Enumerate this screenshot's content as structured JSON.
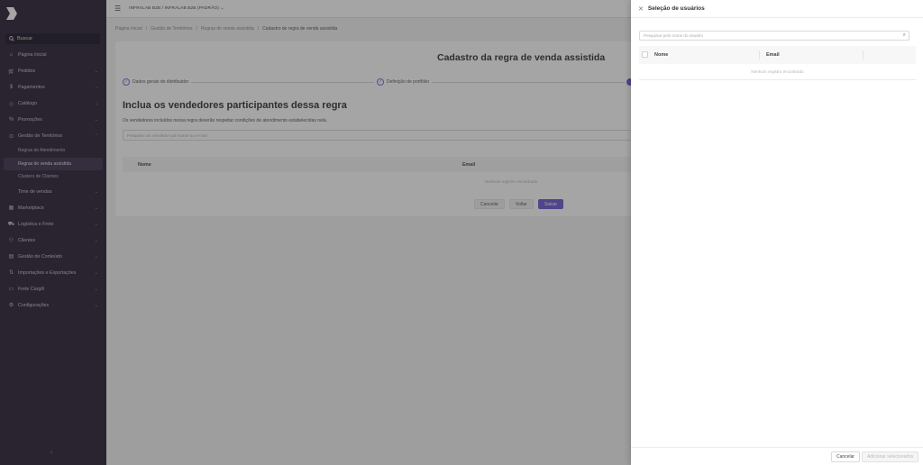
{
  "sidebar": {
    "search_label": "Buscar",
    "items": [
      {
        "label": "Página Inicial",
        "icon": "home-icon",
        "chevron": false
      },
      {
        "label": "Pedidos",
        "icon": "cart-icon",
        "chevron": true
      },
      {
        "label": "Pagamentos",
        "icon": "dollar-icon",
        "chevron": true
      },
      {
        "label": "Catálogo",
        "icon": "tag-icon",
        "chevron": true
      },
      {
        "label": "Promoções",
        "icon": "percent-icon",
        "chevron": true
      },
      {
        "label": "Gestão de Territórios",
        "icon": "pin-icon",
        "chevron": true,
        "expanded": true
      }
    ],
    "subitems": [
      {
        "label": "Regras de Atendimento",
        "active": false
      },
      {
        "label": "Regras de venda assistida",
        "active": true
      },
      {
        "label": "Clusters de Clientes",
        "active": false
      }
    ],
    "forca_vendas": "Time de vendas",
    "items2": [
      {
        "label": "Marketplace",
        "icon": "grid-icon"
      },
      {
        "label": "Logística e Frete",
        "icon": "truck-icon"
      },
      {
        "label": "Clientes",
        "icon": "users-icon"
      },
      {
        "label": "Gestão de Conteúdo",
        "icon": "content-icon"
      },
      {
        "label": "Importações e Exportações",
        "icon": "import-icon"
      },
      {
        "label": "Frete Cargill",
        "icon": "freight-icon"
      },
      {
        "label": "Configurações",
        "icon": "gear-icon"
      }
    ]
  },
  "topbar": {
    "store": "INFRALAB B2B / INFRALAB B2B (PADRÃO) ⌄"
  },
  "breadcrumb": [
    "Página Inicial",
    "Gestão de Territórios",
    "Regras de venda assistida",
    "Cadastro de regra de venda assistida"
  ],
  "main": {
    "title": "Cadastro da regra de venda assistida",
    "steps": [
      {
        "label": "Dados gerais do distribuidor"
      },
      {
        "label": "Definição de portfólio"
      }
    ],
    "section_title": "Inclua os vendedores participantes dessa regra",
    "section_desc": "Os vendedores incluídos nessa regra deverão respeitar condições de atendimento estabelecidas nela.",
    "search_placeholder": "Pesquise um vendedor por Nome ou e-mail",
    "table": {
      "col_name": "Nome",
      "col_email": "Email",
      "empty": "Nenhum registro encontrado"
    },
    "buttons": {
      "cancel": "Cancelar",
      "back": "Voltar",
      "save": "Salvar"
    }
  },
  "drawer": {
    "title": "Seleção de usuários",
    "search_placeholder": "Pesquisar pelo nome do usuário",
    "table": {
      "col_name": "Nome",
      "col_email": "Email",
      "empty": "Nenhum registro encontrado"
    },
    "buttons": {
      "cancel": "Cancelar",
      "add": "Adicionar selecionados"
    }
  },
  "colors": {
    "sidebar": "#2b2238",
    "primary": "#6a5ad2"
  }
}
